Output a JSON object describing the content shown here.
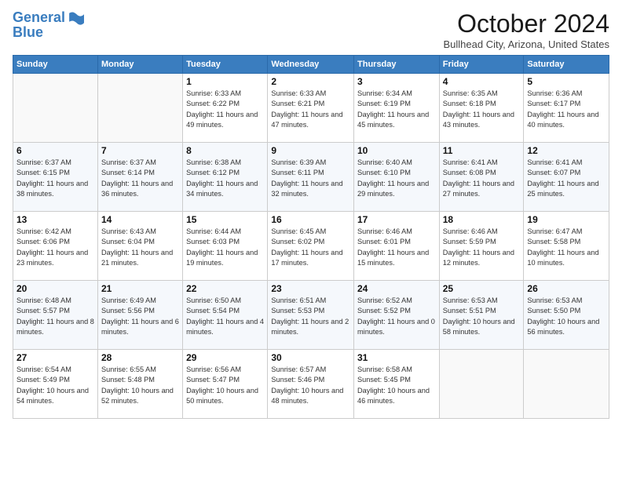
{
  "logo": {
    "line1": "General",
    "line2": "Blue"
  },
  "title": "October 2024",
  "subtitle": "Bullhead City, Arizona, United States",
  "days_of_week": [
    "Sunday",
    "Monday",
    "Tuesday",
    "Wednesday",
    "Thursday",
    "Friday",
    "Saturday"
  ],
  "weeks": [
    [
      {
        "day": "",
        "info": ""
      },
      {
        "day": "",
        "info": ""
      },
      {
        "day": "1",
        "info": "Sunrise: 6:33 AM\nSunset: 6:22 PM\nDaylight: 11 hours and 49 minutes."
      },
      {
        "day": "2",
        "info": "Sunrise: 6:33 AM\nSunset: 6:21 PM\nDaylight: 11 hours and 47 minutes."
      },
      {
        "day": "3",
        "info": "Sunrise: 6:34 AM\nSunset: 6:19 PM\nDaylight: 11 hours and 45 minutes."
      },
      {
        "day": "4",
        "info": "Sunrise: 6:35 AM\nSunset: 6:18 PM\nDaylight: 11 hours and 43 minutes."
      },
      {
        "day": "5",
        "info": "Sunrise: 6:36 AM\nSunset: 6:17 PM\nDaylight: 11 hours and 40 minutes."
      }
    ],
    [
      {
        "day": "6",
        "info": "Sunrise: 6:37 AM\nSunset: 6:15 PM\nDaylight: 11 hours and 38 minutes."
      },
      {
        "day": "7",
        "info": "Sunrise: 6:37 AM\nSunset: 6:14 PM\nDaylight: 11 hours and 36 minutes."
      },
      {
        "day": "8",
        "info": "Sunrise: 6:38 AM\nSunset: 6:12 PM\nDaylight: 11 hours and 34 minutes."
      },
      {
        "day": "9",
        "info": "Sunrise: 6:39 AM\nSunset: 6:11 PM\nDaylight: 11 hours and 32 minutes."
      },
      {
        "day": "10",
        "info": "Sunrise: 6:40 AM\nSunset: 6:10 PM\nDaylight: 11 hours and 29 minutes."
      },
      {
        "day": "11",
        "info": "Sunrise: 6:41 AM\nSunset: 6:08 PM\nDaylight: 11 hours and 27 minutes."
      },
      {
        "day": "12",
        "info": "Sunrise: 6:41 AM\nSunset: 6:07 PM\nDaylight: 11 hours and 25 minutes."
      }
    ],
    [
      {
        "day": "13",
        "info": "Sunrise: 6:42 AM\nSunset: 6:06 PM\nDaylight: 11 hours and 23 minutes."
      },
      {
        "day": "14",
        "info": "Sunrise: 6:43 AM\nSunset: 6:04 PM\nDaylight: 11 hours and 21 minutes."
      },
      {
        "day": "15",
        "info": "Sunrise: 6:44 AM\nSunset: 6:03 PM\nDaylight: 11 hours and 19 minutes."
      },
      {
        "day": "16",
        "info": "Sunrise: 6:45 AM\nSunset: 6:02 PM\nDaylight: 11 hours and 17 minutes."
      },
      {
        "day": "17",
        "info": "Sunrise: 6:46 AM\nSunset: 6:01 PM\nDaylight: 11 hours and 15 minutes."
      },
      {
        "day": "18",
        "info": "Sunrise: 6:46 AM\nSunset: 5:59 PM\nDaylight: 11 hours and 12 minutes."
      },
      {
        "day": "19",
        "info": "Sunrise: 6:47 AM\nSunset: 5:58 PM\nDaylight: 11 hours and 10 minutes."
      }
    ],
    [
      {
        "day": "20",
        "info": "Sunrise: 6:48 AM\nSunset: 5:57 PM\nDaylight: 11 hours and 8 minutes."
      },
      {
        "day": "21",
        "info": "Sunrise: 6:49 AM\nSunset: 5:56 PM\nDaylight: 11 hours and 6 minutes."
      },
      {
        "day": "22",
        "info": "Sunrise: 6:50 AM\nSunset: 5:54 PM\nDaylight: 11 hours and 4 minutes."
      },
      {
        "day": "23",
        "info": "Sunrise: 6:51 AM\nSunset: 5:53 PM\nDaylight: 11 hours and 2 minutes."
      },
      {
        "day": "24",
        "info": "Sunrise: 6:52 AM\nSunset: 5:52 PM\nDaylight: 11 hours and 0 minutes."
      },
      {
        "day": "25",
        "info": "Sunrise: 6:53 AM\nSunset: 5:51 PM\nDaylight: 10 hours and 58 minutes."
      },
      {
        "day": "26",
        "info": "Sunrise: 6:53 AM\nSunset: 5:50 PM\nDaylight: 10 hours and 56 minutes."
      }
    ],
    [
      {
        "day": "27",
        "info": "Sunrise: 6:54 AM\nSunset: 5:49 PM\nDaylight: 10 hours and 54 minutes."
      },
      {
        "day": "28",
        "info": "Sunrise: 6:55 AM\nSunset: 5:48 PM\nDaylight: 10 hours and 52 minutes."
      },
      {
        "day": "29",
        "info": "Sunrise: 6:56 AM\nSunset: 5:47 PM\nDaylight: 10 hours and 50 minutes."
      },
      {
        "day": "30",
        "info": "Sunrise: 6:57 AM\nSunset: 5:46 PM\nDaylight: 10 hours and 48 minutes."
      },
      {
        "day": "31",
        "info": "Sunrise: 6:58 AM\nSunset: 5:45 PM\nDaylight: 10 hours and 46 minutes."
      },
      {
        "day": "",
        "info": ""
      },
      {
        "day": "",
        "info": ""
      }
    ]
  ]
}
